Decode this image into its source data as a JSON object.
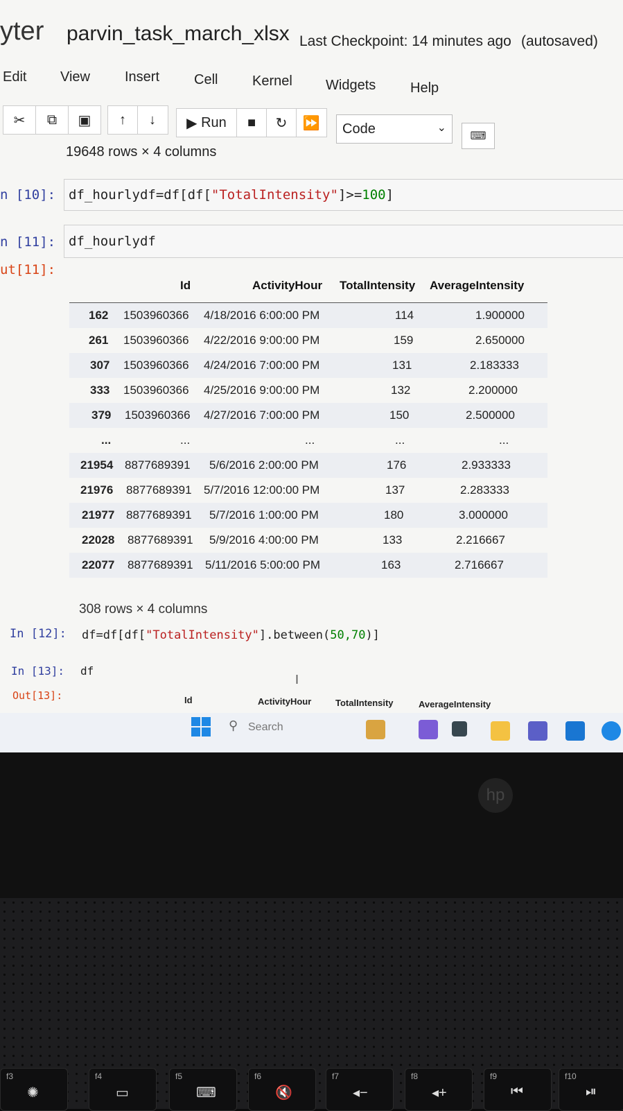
{
  "header": {
    "logo_text": "yter",
    "notebook_name": "parvin_task_march_xlsx",
    "checkpoint": "Last Checkpoint: 14 minutes ago",
    "autosaved": "(autosaved)"
  },
  "menu": [
    "Edit",
    "View",
    "Insert",
    "Cell",
    "Kernel",
    "Widgets",
    "Help"
  ],
  "toolbar": {
    "run_label": "Run",
    "cell_type": "Code",
    "icons": [
      "cut-icon",
      "copy-icon",
      "paste-icon",
      "move-up-icon",
      "move-down-icon",
      "run-icon",
      "stop-icon",
      "restart-icon",
      "fast-forward-icon",
      "keyboard-icon"
    ]
  },
  "top_summary": "19648 rows × 4 columns",
  "cells": [
    {
      "prompt": "[10]:",
      "code_a": "df_hourlydf=df[df[",
      "code_str": "\"TotalIntensity\"",
      "code_b": "]>=",
      "code_num": "100",
      "code_c": "]"
    },
    {
      "prompt": "[11]:",
      "code": "df_hourlydf"
    },
    {
      "prompt": "In [12]:",
      "code_a": "df=df[df[",
      "code_str": "\"TotalIntensity\"",
      "code_b": "].between(",
      "code_num": "50,70",
      "code_c": ")]"
    },
    {
      "prompt": "In [13]:",
      "code": "df"
    }
  ],
  "output11": {
    "prompt": "ut[11]:",
    "columns": [
      "Id",
      "ActivityHour",
      "TotalIntensity",
      "AverageIntensity"
    ],
    "rows": [
      [
        "162",
        "1503960366",
        "4/18/2016 6:00:00 PM",
        "114",
        "1.900000"
      ],
      [
        "261",
        "1503960366",
        "4/22/2016 9:00:00 PM",
        "159",
        "2.650000"
      ],
      [
        "307",
        "1503960366",
        "4/24/2016 7:00:00 PM",
        "131",
        "2.183333"
      ],
      [
        "333",
        "1503960366",
        "4/25/2016 9:00:00 PM",
        "132",
        "2.200000"
      ],
      [
        "379",
        "1503960366",
        "4/27/2016 7:00:00 PM",
        "150",
        "2.500000"
      ],
      [
        "...",
        "...",
        "...",
        "...",
        "..."
      ],
      [
        "21954",
        "8877689391",
        "5/6/2016 2:00:00 PM",
        "176",
        "2.933333"
      ],
      [
        "21976",
        "8877689391",
        "5/7/2016 12:00:00 PM",
        "137",
        "2.283333"
      ],
      [
        "21977",
        "8877689391",
        "5/7/2016 1:00:00 PM",
        "180",
        "3.000000"
      ],
      [
        "22028",
        "8877689391",
        "5/9/2016 4:00:00 PM",
        "133",
        "2.216667"
      ],
      [
        "22077",
        "8877689391",
        "5/11/2016 5:00:00 PM",
        "163",
        "2.716667"
      ]
    ],
    "summary": "308 rows × 4 columns"
  },
  "output13": {
    "prompt": "Out[13]:",
    "columns": [
      "Id",
      "ActivityHour",
      "TotalIntensity",
      "AverageIntensity"
    ]
  },
  "taskbar": {
    "search_placeholder": "Search"
  },
  "keyboard": {
    "fkeys": [
      "f3",
      "f4",
      "f5",
      "f6",
      "f7",
      "f8",
      "f9",
      "f10"
    ]
  }
}
